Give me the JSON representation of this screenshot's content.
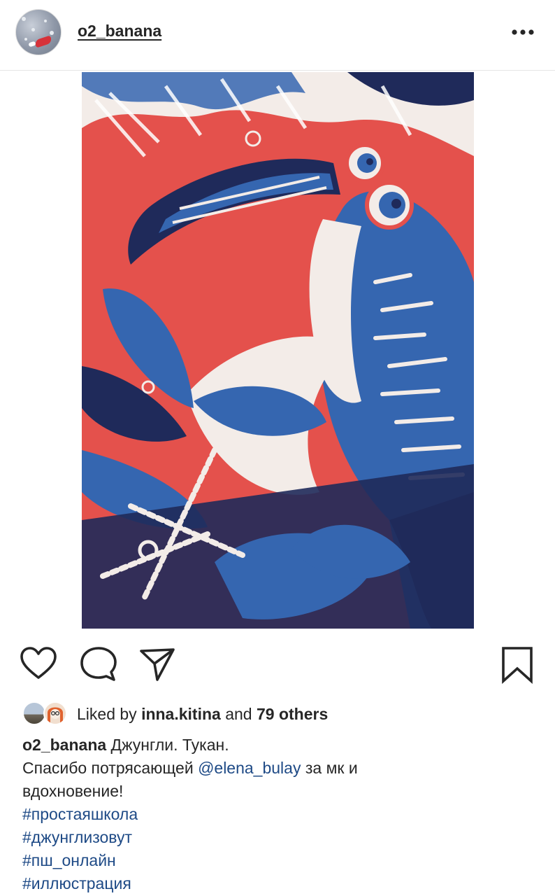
{
  "post": {
    "username": "o2_banana",
    "image_alt": "Джунгли. Тукан. — linocut illustration of a toucan in red, blue and white"
  },
  "likes": {
    "prefix": "Liked by",
    "user": "inna.kitina",
    "middle": "and",
    "others": "79 others"
  },
  "caption": {
    "username": "o2_banana",
    "title": "Джунгли. Тукан.",
    "line2_before": "Спасибо потрясающей",
    "mention": "@elena_bulay",
    "line2_after": "за мк и",
    "line3": "вдохновение!",
    "hashtags": [
      "#простаяшкола",
      "#джунглизовут",
      "#пш_онлайн",
      "#иллюстрация"
    ]
  },
  "icons": [
    "more-icon",
    "heart-icon",
    "comment-icon",
    "share-icon",
    "bookmark-icon"
  ],
  "colors": {
    "link": "#1e4a86",
    "text": "#262626",
    "art_red": "#e4514c",
    "art_blue": "#3566b0",
    "art_navy": "#1f2a5a"
  }
}
